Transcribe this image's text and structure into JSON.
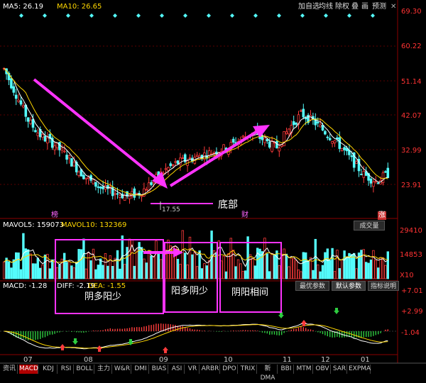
{
  "toolbar": {
    "buttons": [
      "加自选",
      "均线",
      "除权",
      "叠",
      "画",
      "预测"
    ]
  },
  "top_legend": {
    "ma5": "MA5: 26.19",
    "ma10": "MA10: 26.65"
  },
  "vol_legend": {
    "mavol5": "MAVOL5: 159073",
    "mavol10": "MAVOL10: 132369",
    "badge": "成交量"
  },
  "macd_legend": {
    "macd": "MACD: -1.28",
    "diff": "DIFF: -2.19",
    "dea": "DEA: -1.55"
  },
  "macd_buttons": [
    "最优参数",
    "默认参数",
    "指标说明"
  ],
  "price_axis": [
    "69.30",
    "60.22",
    "51.14",
    "42.07",
    "32.99",
    "23.91"
  ],
  "vol_axis": [
    "29410",
    "14853",
    "X10"
  ],
  "macd_axis": [
    "+7.01",
    "+2.99",
    "-1.04"
  ],
  "months": [
    "07",
    "08",
    "09",
    "10",
    "11",
    "12",
    "01"
  ],
  "markers": {
    "m1": "榜",
    "m2": "财",
    "m3": "涨"
  },
  "annotations": {
    "low_value": "17.55",
    "bottom": "底部",
    "box1": "阴多阳少",
    "box2": "阳多阴少",
    "box3": "阴阳相间"
  },
  "tabs": [
    "资讯",
    "MACD",
    "KDJ",
    "RSI",
    "BOLL",
    "主力",
    "W&R",
    "DMI",
    "BIAS",
    "ASI",
    "VR",
    "ARBR",
    "DPO",
    "TRIX",
    "新DMA",
    "BBI",
    "MTM",
    "OBV",
    "SAR",
    "EXPMA"
  ],
  "colors": {
    "up": "#ff3b3b",
    "down": "#54fcfc",
    "ma5": "#ffffff",
    "ma10": "#ffd700",
    "accent": "#ff33ff",
    "axis": "#ff3333"
  },
  "chart_data": {
    "type": "candlestick",
    "price_axis": {
      "min": 17.55,
      "max": 69.3,
      "ticks": [
        69.3,
        60.22,
        51.14,
        42.07,
        32.99,
        23.91
      ]
    },
    "x_months": [
      "07",
      "08",
      "09",
      "10",
      "11",
      "12",
      "01"
    ],
    "close_path": [
      54,
      47,
      40,
      36,
      34,
      31,
      27,
      24,
      22,
      21,
      20,
      21,
      24,
      27,
      29,
      30,
      31,
      32,
      33,
      35,
      37,
      35,
      33,
      38,
      42,
      40,
      37,
      34,
      30,
      26,
      24,
      26
    ],
    "low_mark": 17.55,
    "macd_axis": {
      "ticks": [
        7.01,
        2.99,
        -1.04
      ]
    },
    "macd_values": {
      "macd": -1.28,
      "diff": -2.19,
      "dea": -1.55
    },
    "volume": {
      "mavol5": 159073,
      "mavol10": 132369,
      "ticks": [
        29410,
        14853
      ]
    }
  }
}
